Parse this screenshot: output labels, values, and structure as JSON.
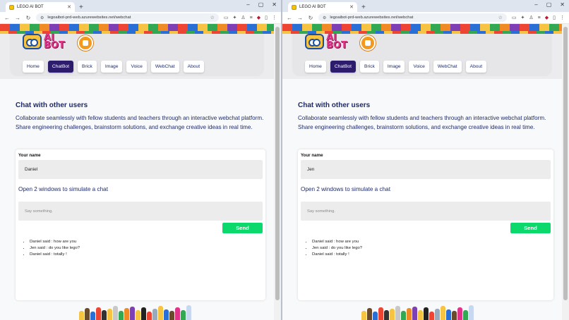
{
  "browser": {
    "tab_title": "LEGO AI BOT",
    "url": "legoaibot-prd-web.azurewebsites.net/webchat"
  },
  "site": {
    "logo_text_line1": "AI",
    "logo_text_line2": "BOT",
    "menu": [
      "Home",
      "ChatBot",
      "Brick",
      "Image",
      "Voice",
      "WebChat",
      "About"
    ],
    "active_menu": "ChatBot"
  },
  "page": {
    "title": "Chat with other users",
    "intro": "Collaborate seamlessly with fellow students and teachers through an interactive webchat platform. Share engineering challenges, brainstorm solutions, and exchange creative ideas in real time.",
    "name_label": "Your name",
    "subtitle": "Open 2 windows to simulate a chat",
    "message_placeholder": "Say something.",
    "send_label": "Send"
  },
  "windows": [
    {
      "user_name": "Daniel",
      "messages": [
        "Daniel said : how are you",
        "Jen said : do you like lego?",
        "Daniel said : totally !"
      ]
    },
    {
      "user_name": "Jen",
      "messages": [
        "Daniel said : how are you",
        "Jen said : do you like lego?",
        "Daniel said : totally !"
      ]
    }
  ],
  "colors": {
    "accent_navy": "#1f2b6b",
    "active_menu_bg": "#2d1b6b",
    "send_green": "#0cd96b",
    "logo_pink": "#e2338a"
  }
}
